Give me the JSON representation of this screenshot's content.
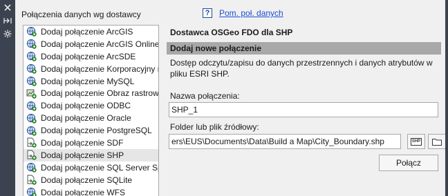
{
  "group_label": "Połączenia danych wg dostawcy",
  "help": {
    "icon_glyph": "?",
    "link_text": "Pom. poł. danych"
  },
  "providers": [
    {
      "label": "Dodaj połączenie ArcGIS",
      "icon": "globe-icon"
    },
    {
      "label": "Dodaj połączenie ArcGIS Online",
      "icon": "globe-icon"
    },
    {
      "label": "Dodaj połączenie ArcSDE",
      "icon": "globe-icon"
    },
    {
      "label": "Dodaj połączenie Korporacyjny r",
      "icon": "globe-icon"
    },
    {
      "label": "Dodaj połączenie MySQL",
      "icon": "globe-icon"
    },
    {
      "label": "Dodaj połączenie Obraz rastrowy",
      "icon": "raster-icon"
    },
    {
      "label": "Dodaj połączenie ODBC",
      "icon": "globe-icon"
    },
    {
      "label": "Dodaj połączenie Oracle",
      "icon": "globe-icon"
    },
    {
      "label": "Dodaj połączenie PostgreSQL",
      "icon": "globe-icon"
    },
    {
      "label": "Dodaj połączenie SDF",
      "icon": "file-arrow-icon"
    },
    {
      "label": "Dodaj połączenie SHP",
      "icon": "file-arrow-icon"
    },
    {
      "label": "Dodaj połączenie SQL Server Spa",
      "icon": "globe-icon"
    },
    {
      "label": "Dodaj połączenie SQLite",
      "icon": "file-arrow-icon"
    },
    {
      "label": "Dodaj połączenie WFS",
      "icon": "globe-icon"
    }
  ],
  "selected_index": 10,
  "details": {
    "title": "Dostawca OSGeo FDO dla SHP",
    "section_header": "Dodaj nowe połączenie",
    "description": "Dostęp odczytu/zapisu do danych przestrzennych i danych atrybutów w pliku ESRI SHP.",
    "name_label": "Nazwa połączenia:",
    "name_value": "SHP_1",
    "source_label": "Folder lub plik źródłowy:",
    "source_value": "ers\\EUS\\Documents\\Data\\Build a Map\\City_Boundary.shp",
    "shp_button_text": "SHP",
    "connect_label": "Połącz"
  },
  "side_strip": {
    "icons": [
      "close-icon",
      "pin-icon",
      "settings-icon"
    ]
  },
  "colors": {
    "strip": "#3c4350",
    "section_header": "#a8a8a8",
    "link": "#1d4ed8",
    "selected_row": "#e6e6e6"
  }
}
